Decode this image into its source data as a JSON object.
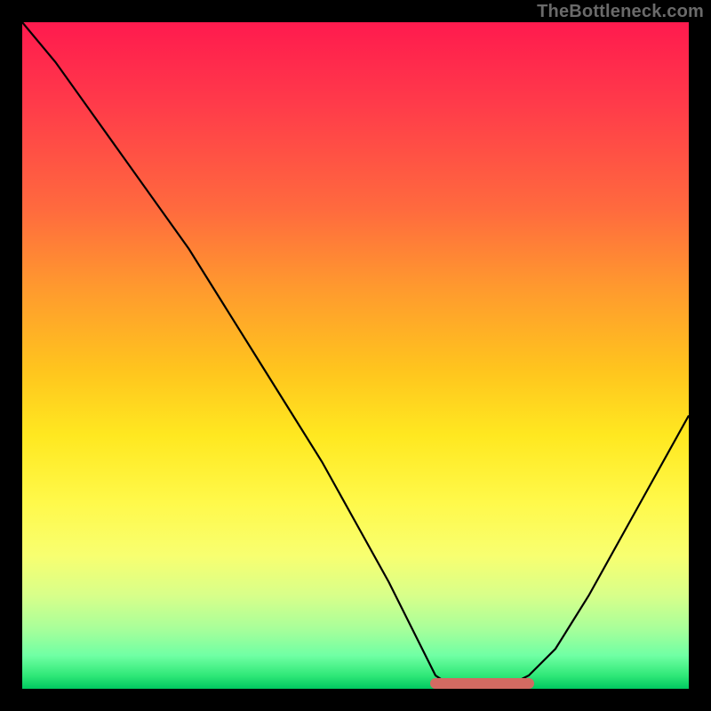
{
  "watermark": "TheBottleneck.com",
  "chart_data": {
    "type": "line",
    "title": "",
    "xlabel": "",
    "ylabel": "",
    "xlim": [
      0,
      100
    ],
    "ylim": [
      0,
      100
    ],
    "grid": false,
    "legend": false,
    "series": [
      {
        "name": "bottleneck-curve",
        "x": [
          0,
          5,
          10,
          15,
          20,
          25,
          30,
          35,
          40,
          45,
          50,
          55,
          60,
          62,
          65,
          68,
          72,
          76,
          80,
          85,
          90,
          95,
          100
        ],
        "y": [
          100,
          94,
          87,
          80,
          73,
          66,
          58,
          50,
          42,
          34,
          25,
          16,
          6,
          2,
          0,
          0,
          0,
          2,
          6,
          14,
          23,
          32,
          41
        ]
      }
    ],
    "annotations": [
      {
        "name": "optimal-range",
        "x_start": 62,
        "x_end": 76,
        "y": 0,
        "color": "#d36a62"
      }
    ],
    "background_gradient": {
      "top_color": "#ff1a4e",
      "bottom_color": "#00c860"
    }
  }
}
